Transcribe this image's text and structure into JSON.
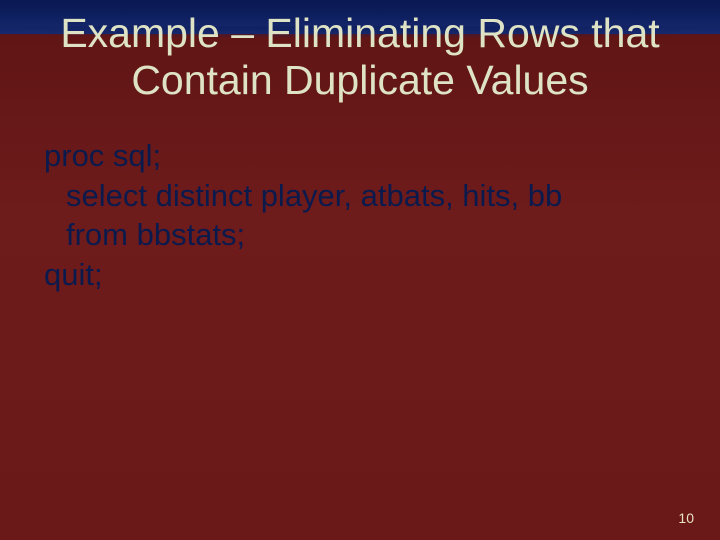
{
  "slide": {
    "title": "Example – Eliminating Rows that Contain Duplicate Values",
    "code": {
      "line1": "proc sql;",
      "line2": "select distinct player, atbats, hits, bb",
      "line3": "from bbstats;",
      "line4": "quit;"
    },
    "page_number": "10"
  }
}
